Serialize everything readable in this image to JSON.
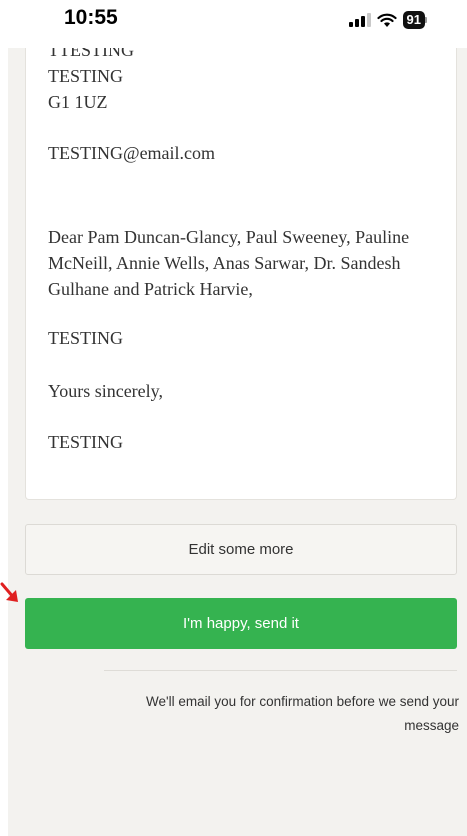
{
  "status_bar": {
    "time": "10:55",
    "battery": "91",
    "icons": [
      "signal-icon",
      "wifi-icon",
      "battery-icon"
    ]
  },
  "letter": {
    "address_line_partial": "TTESTING",
    "address_line": "TESTING",
    "postcode": "G1 1UZ",
    "email": "TESTING@email.com",
    "salutation": "Dear Pam Duncan-Glancy, Paul Sweeney, Pauline McNeill, Annie Wells, Anas Sarwar, Dr. Sandesh Gulhane and Patrick Harvie,",
    "body": "TESTING",
    "closing": "Yours sincerely,",
    "signature": "TESTING"
  },
  "actions": {
    "edit_label": "Edit some more",
    "send_label": "I'm happy, send it"
  },
  "confirmation_note": "We'll email you for confirmation before we send your message",
  "colors": {
    "send_button": "#35b350",
    "arrow": "#e02020",
    "page_background": "#f3f2ef"
  }
}
